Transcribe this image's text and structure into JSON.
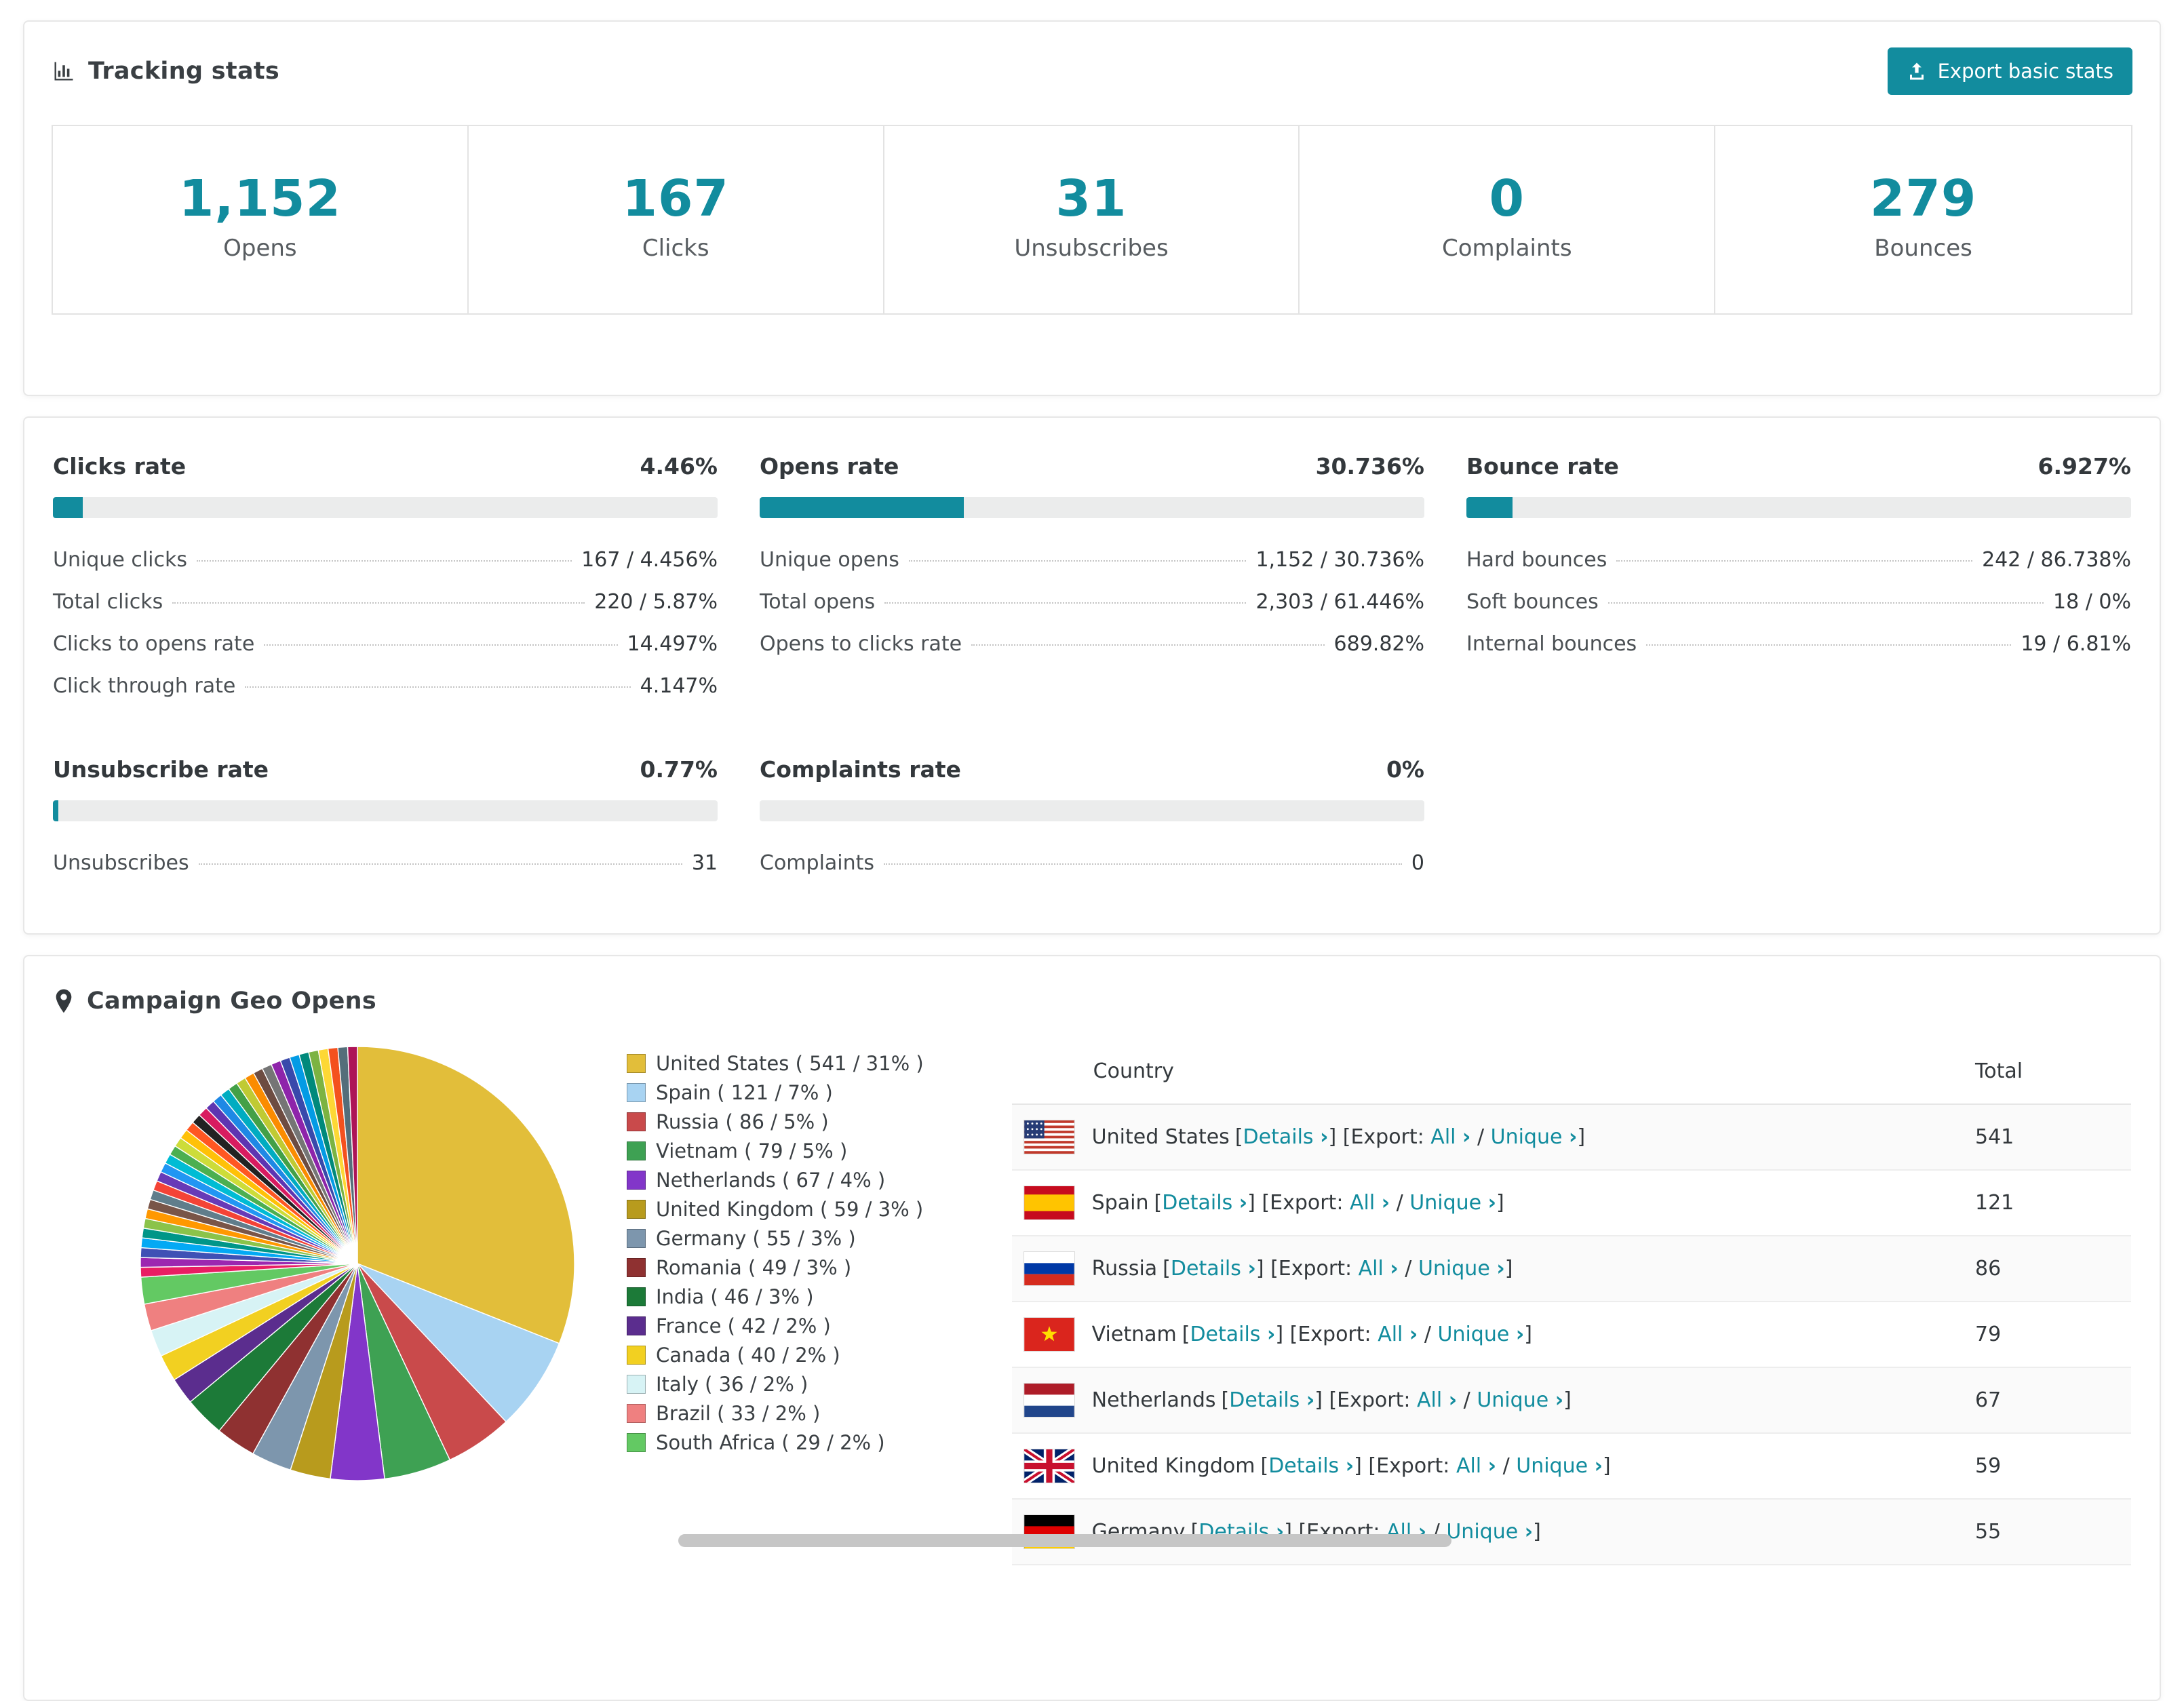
{
  "colors": {
    "accent": "#128c9e"
  },
  "tracking": {
    "title": "Tracking stats",
    "export_label": "Export basic stats",
    "stats": [
      {
        "value": "1,152",
        "label": "Opens"
      },
      {
        "value": "167",
        "label": "Clicks"
      },
      {
        "value": "31",
        "label": "Unsubscribes"
      },
      {
        "value": "0",
        "label": "Complaints"
      },
      {
        "value": "279",
        "label": "Bounces"
      }
    ]
  },
  "rates": [
    {
      "title": "Clicks rate",
      "value": "4.46%",
      "pct": 4.46,
      "rows": [
        {
          "label": "Unique clicks",
          "value": "167 / 4.456%"
        },
        {
          "label": "Total clicks",
          "value": "220 / 5.87%"
        },
        {
          "label": "Clicks to opens rate",
          "value": "14.497%"
        },
        {
          "label": "Click through rate",
          "value": "4.147%"
        }
      ]
    },
    {
      "title": "Opens rate",
      "value": "30.736%",
      "pct": 30.736,
      "rows": [
        {
          "label": "Unique opens",
          "value": "1,152 / 30.736%"
        },
        {
          "label": "Total opens",
          "value": "2,303 / 61.446%"
        },
        {
          "label": "Opens to clicks rate",
          "value": "689.82%"
        }
      ]
    },
    {
      "title": "Bounce rate",
      "value": "6.927%",
      "pct": 6.927,
      "rows": [
        {
          "label": "Hard bounces",
          "value": "242 / 86.738%"
        },
        {
          "label": "Soft bounces",
          "value": "18 / 0%"
        },
        {
          "label": "Internal bounces",
          "value": "19 / 6.81%"
        }
      ]
    },
    {
      "title": "Unsubscribe rate",
      "value": "0.77%",
      "pct": 0.77,
      "rows": [
        {
          "label": "Unsubscribes",
          "value": "31"
        }
      ]
    },
    {
      "title": "Complaints rate",
      "value": "0%",
      "pct": 0,
      "rows": [
        {
          "label": "Complaints",
          "value": "0"
        }
      ]
    }
  ],
  "geo": {
    "title": "Campaign Geo Opens",
    "table": {
      "headers": {
        "country": "Country",
        "total": "Total"
      },
      "labels": {
        "details": "Details",
        "export_prefix": "Export:",
        "all": "All",
        "unique": "Unique",
        "arrow": "›",
        "bracket_open": "[",
        "bracket_close": "]",
        "slash": "/"
      },
      "rows": [
        {
          "country": "United States",
          "flag": "us",
          "total": "541"
        },
        {
          "country": "Spain",
          "flag": "es",
          "total": "121"
        },
        {
          "country": "Russia",
          "flag": "ru",
          "total": "86"
        },
        {
          "country": "Vietnam",
          "flag": "vn",
          "total": "79"
        },
        {
          "country": "Netherlands",
          "flag": "nl",
          "total": "67"
        },
        {
          "country": "United Kingdom",
          "flag": "gb",
          "total": "59"
        },
        {
          "country": "Germany",
          "flag": "de",
          "total": "55"
        }
      ]
    }
  },
  "chart_data": {
    "type": "pie",
    "title": "Campaign Geo Opens",
    "legend_position": "right",
    "series": [
      {
        "name": "United States",
        "value": 541,
        "pct": 31,
        "color": "#e2be3a",
        "label": "United States ( 541 / 31% )"
      },
      {
        "name": "Spain",
        "value": 121,
        "pct": 7,
        "color": "#a8d3f2",
        "label": "Spain ( 121 / 7% )"
      },
      {
        "name": "Russia",
        "value": 86,
        "pct": 5,
        "color": "#c94a4b",
        "label": "Russia ( 86 / 5% )"
      },
      {
        "name": "Vietnam",
        "value": 79,
        "pct": 5,
        "color": "#3ea153",
        "label": "Vietnam ( 79 / 5% )"
      },
      {
        "name": "Netherlands",
        "value": 67,
        "pct": 4,
        "color": "#8236c9",
        "label": "Netherlands ( 67 / 4% )"
      },
      {
        "name": "United Kingdom",
        "value": 59,
        "pct": 3,
        "color": "#b89b1d",
        "label": "United Kingdom ( 59 / 3% )"
      },
      {
        "name": "Germany",
        "value": 55,
        "pct": 3,
        "color": "#7d96ad",
        "label": "Germany ( 55 / 3% )"
      },
      {
        "name": "Romania",
        "value": 49,
        "pct": 3,
        "color": "#8f3131",
        "label": "Romania ( 49 / 3% )"
      },
      {
        "name": "India",
        "value": 46,
        "pct": 3,
        "color": "#1c7a38",
        "label": "India ( 46 / 3% )"
      },
      {
        "name": "France",
        "value": 42,
        "pct": 2,
        "color": "#5b2d8e",
        "label": "France ( 42 / 2% )"
      },
      {
        "name": "Canada",
        "value": 40,
        "pct": 2,
        "color": "#f2d021",
        "label": "Canada ( 40 / 2% )"
      },
      {
        "name": "Italy",
        "value": 36,
        "pct": 2,
        "color": "#d7f3f5",
        "label": "Italy ( 36 / 2% )"
      },
      {
        "name": "Brazil",
        "value": 33,
        "pct": 2,
        "color": "#ef8080",
        "label": "Brazil ( 33 / 2% )"
      },
      {
        "name": "South Africa",
        "value": 29,
        "pct": 2,
        "color": "#63c963",
        "label": "South Africa ( 29 / 2% )"
      }
    ],
    "micro_slices": {
      "pct_total": 26,
      "count": 36,
      "colors": [
        "#e91e63",
        "#9c27b0",
        "#3f51b5",
        "#03a9f4",
        "#009688",
        "#8bc34a",
        "#ff9800",
        "#795548",
        "#607d8b",
        "#f44336",
        "#673ab7",
        "#2196f3",
        "#00bcd4",
        "#4caf50",
        "#cddc39",
        "#ffc107",
        "#ff5722",
        "#222222",
        "#d81b60",
        "#5e35b1",
        "#1e88e5",
        "#00acc1",
        "#43a047",
        "#c0ca33",
        "#fb8c00",
        "#6d4c41",
        "#757575",
        "#8e24aa",
        "#3949ab",
        "#039be5",
        "#00897b",
        "#7cb342",
        "#fdd835",
        "#f4511e",
        "#546e7a",
        "#ad1457"
      ]
    }
  }
}
